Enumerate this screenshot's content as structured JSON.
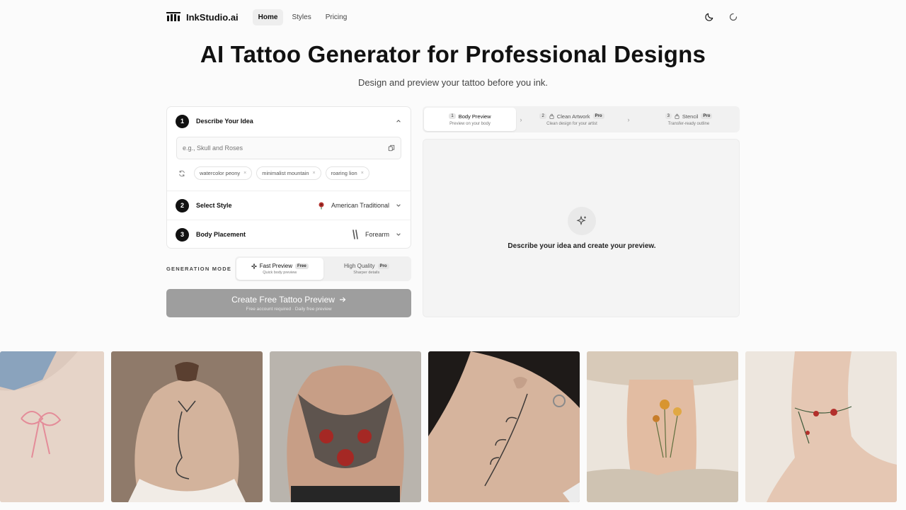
{
  "brand": {
    "name": "InkStudio.ai"
  },
  "nav": {
    "links": [
      "Home",
      "Styles",
      "Pricing"
    ],
    "active": "Home"
  },
  "hero": {
    "title": "AI Tattoo Generator for Professional Designs",
    "subtitle": "Design and preview your tattoo before you ink."
  },
  "form": {
    "idea": {
      "num": "1",
      "title": "Describe Your Idea",
      "placeholder": "e.g., Skull and Roses",
      "chips": [
        "watercolor peony",
        "minimalist mountain",
        "roaring lion"
      ]
    },
    "style": {
      "num": "2",
      "title": "Select Style",
      "value": "American Traditional"
    },
    "placement": {
      "num": "3",
      "title": "Body Placement",
      "value": "Forearm"
    }
  },
  "generation": {
    "label": "GENERATION MODE",
    "options": [
      {
        "label": "Fast Preview",
        "badge": "Free",
        "sub": "Quick body preview"
      },
      {
        "label": "High Quality",
        "badge": "Pro",
        "sub": "Sharper details"
      }
    ]
  },
  "cta": {
    "label": "Create Free Tattoo Preview",
    "sub": "Free account required · Daily free preview"
  },
  "steps": [
    {
      "num": "1",
      "label": "Body Preview",
      "sub": "Preview on your body"
    },
    {
      "num": "2",
      "label": "Clean Artwork",
      "badge": "Pro",
      "sub": "Clean design for your artist"
    },
    {
      "num": "3",
      "label": "Stencil",
      "badge": "Pro",
      "sub": "Transfer-ready outline"
    }
  ],
  "preview": {
    "empty_text": "Describe your idea and create your preview."
  },
  "gallery": [
    {
      "name": "pink-bow-thigh"
    },
    {
      "name": "fox-back"
    },
    {
      "name": "angel-warrior-back"
    },
    {
      "name": "floral-neck"
    },
    {
      "name": "wildflowers-ankle"
    },
    {
      "name": "rose-vine-ankle"
    }
  ],
  "colors": {
    "cta_disabled": "#9e9e9e",
    "accent": "#111111"
  }
}
